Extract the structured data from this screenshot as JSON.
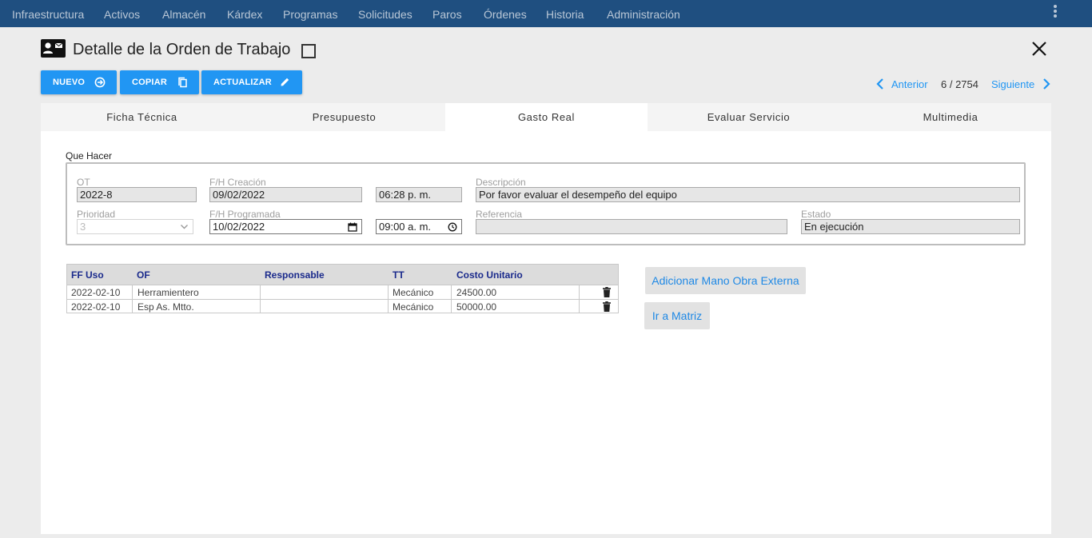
{
  "nav": {
    "items": [
      "Infraestructura",
      "Activos",
      "Almacén",
      "Kárdex",
      "Programas",
      "Solicitudes",
      "Paros",
      "Órdenes",
      "Historia",
      "Administración"
    ]
  },
  "header": {
    "title": "Detalle de la Orden de Trabajo"
  },
  "toolbar": {
    "new_label": "NUEVO",
    "copy_label": "COPIAR",
    "update_label": "ACTUALIZAR"
  },
  "pager": {
    "prev_label": "Anterior",
    "position": "6 / 2754",
    "next_label": "Siguiente"
  },
  "tabs": [
    "Ficha Técnica",
    "Presupuesto",
    "Gasto Real",
    "Evaluar Servicio",
    "Multimedia"
  ],
  "active_tab": "Gasto Real",
  "form": {
    "section_label": "Que Hacer",
    "ot_label": "OT",
    "ot_value": "2022-8",
    "created_label": "F/H Creación",
    "created_date": "09/02/2022",
    "created_time": "06:28  p. m.",
    "description_label": "Descripción",
    "description_value": "Por favor evaluar el desempeño del equipo",
    "priority_label": "Prioridad",
    "priority_value": "3",
    "scheduled_label": "F/H Programada",
    "scheduled_date": "10/02/2022",
    "scheduled_time": "09:00  a. m.",
    "reference_label": "Referencia",
    "reference_value": "",
    "status_label": "Estado",
    "status_value": "En ejecución"
  },
  "table": {
    "columns": [
      "FF Uso",
      "OF",
      "Responsable",
      "TT",
      "Costo Unitario"
    ],
    "rows": [
      {
        "date": "2022-02-10",
        "of": "Herramientero",
        "responsable": "",
        "tt": "Mecánico",
        "cost": "24500.00"
      },
      {
        "date": "2022-02-10",
        "of": "Esp As. Mtto.",
        "responsable": "",
        "tt": "Mecánico",
        "cost": "50000.00"
      }
    ]
  },
  "side_buttons": {
    "add_external_label": "Adicionar Mano Obra Externa",
    "matrix_label": "Ir a Matriz"
  },
  "colors": {
    "nav_bg": "#1f4f80",
    "accent": "#2196f3",
    "link": "#1e88e5",
    "table_header_text": "#1a2a8c"
  },
  "icons": [
    "id-card-icon",
    "checkbox-icon",
    "close-icon",
    "add-circle-icon",
    "copy-icon",
    "pencil-icon",
    "chevron-left-icon",
    "chevron-right-icon",
    "calendar-icon",
    "clock-icon",
    "chevron-down-icon",
    "trash-icon",
    "more-vert-icon"
  ]
}
